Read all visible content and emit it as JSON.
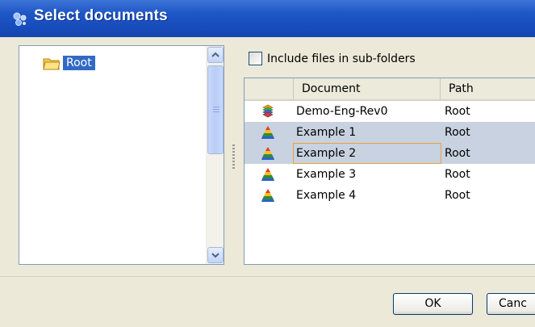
{
  "window": {
    "title": "Select documents",
    "icon": "gear-cluster-icon"
  },
  "tree": {
    "items": [
      {
        "label": "Root",
        "icon": "folder-icon",
        "selected": true
      }
    ]
  },
  "options": {
    "include_subfolders_label": "Include files in sub-folders",
    "include_subfolders_checked": false
  },
  "table": {
    "columns": {
      "icon": "",
      "document": "Document",
      "path": "Path"
    },
    "rows": [
      {
        "icon": "stack-document-icon",
        "document": "Demo-Eng-Rev0",
        "path": "Root",
        "selected": false
      },
      {
        "icon": "pyramid-document-icon",
        "document": "Example 1",
        "path": "Root",
        "selected": true
      },
      {
        "icon": "pyramid-document-icon",
        "document": "Example 2",
        "path": "Root",
        "selected": true
      },
      {
        "icon": "pyramid-document-icon",
        "document": "Example 3",
        "path": "Root",
        "selected": false
      },
      {
        "icon": "pyramid-document-icon",
        "document": "Example 4",
        "path": "Root",
        "selected": false
      }
    ]
  },
  "buttons": {
    "ok": "OK",
    "cancel": "Canc"
  },
  "colors": {
    "titlebar": "#1f57c7",
    "selection": "#316ac5",
    "row_selected": "#c8d2e0",
    "focus": "#e9a33a"
  }
}
